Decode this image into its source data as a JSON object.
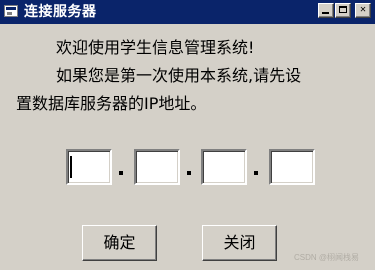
{
  "window": {
    "title": "连接服务器"
  },
  "message": {
    "line1": "欢迎使用学生信息管理系统!",
    "line2": "如果您是第一次使用本系统,请先设",
    "line3": "置数据库服务器的IP地址。"
  },
  "ip_fields": [
    "",
    "",
    "",
    ""
  ],
  "buttons": {
    "ok_label": "确定",
    "close_label": "关闭"
  },
  "watermark": "CSDN @栩闻栈易",
  "colors": {
    "titlebar": "#0a246a",
    "window_bg": "#d4d0c8"
  },
  "icons": {
    "app": "window-icon",
    "minimize": "minimize-icon",
    "maximize": "maximize-icon",
    "close": "close-icon"
  }
}
